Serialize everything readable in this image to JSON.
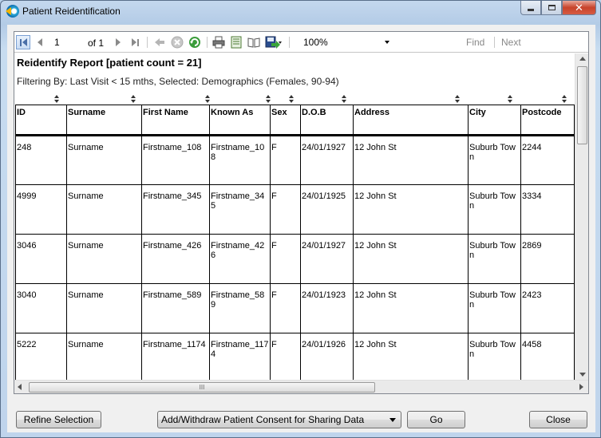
{
  "window": {
    "title": "Patient Reidentification"
  },
  "toolbar": {
    "page_value": "1",
    "page_of": "of 1",
    "zoom": "100%",
    "find": "Find",
    "next": "Next"
  },
  "report": {
    "title": "Reidentify Report  [patient count = 21]",
    "filter": "Filtering By: Last Visit < 15 mths, Selected: Demographics (Females, 90-94)",
    "columns": [
      "ID",
      "Surname",
      "First Name",
      "Known As",
      "Sex",
      "D.O.B",
      "Address",
      "City",
      "Postcode"
    ],
    "rows": [
      [
        "248",
        "Surname",
        "Firstname_108",
        "Firstname_108",
        "F",
        "24/01/1927",
        "12 John St",
        "Suburb Town",
        "2244"
      ],
      [
        "4999",
        "Surname",
        "Firstname_345",
        "Firstname_345",
        "F",
        "24/01/1925",
        "12 John St",
        "Suburb Town",
        "3334"
      ],
      [
        "3046",
        "Surname",
        "Firstname_426",
        "Firstname_426",
        "F",
        "24/01/1927",
        "12 John St",
        "Suburb Town",
        "2869"
      ],
      [
        "3040",
        "Surname",
        "Firstname_589",
        "Firstname_589",
        "F",
        "24/01/1923",
        "12 John St",
        "Suburb Town",
        "2423"
      ],
      [
        "5222",
        "Surname",
        "Firstname_1174",
        "Firstname_1174",
        "F",
        "24/01/1926",
        "12 John St",
        "Suburb Town",
        "4458"
      ]
    ]
  },
  "scroll": {
    "hthumb_grip": "III"
  },
  "footer": {
    "refine": "Refine Selection",
    "action": "Add/Withdraw Patient Consent for Sharing Data",
    "go": "Go",
    "close": "Close"
  }
}
